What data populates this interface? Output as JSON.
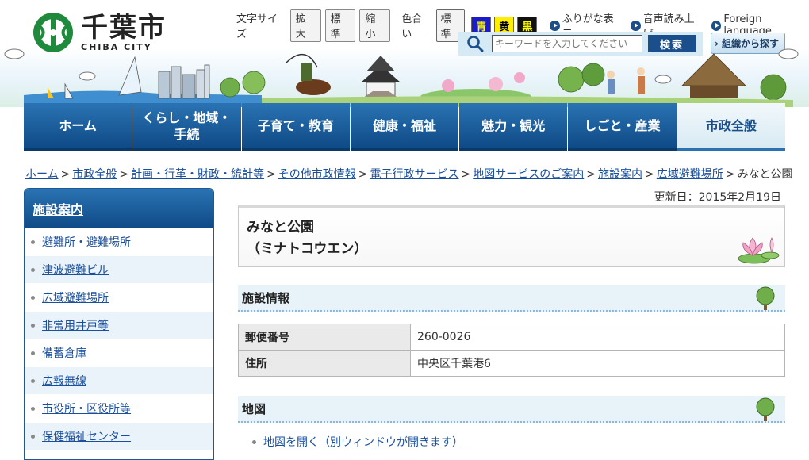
{
  "header": {
    "logo_title": "千葉市",
    "logo_sub": "CHIBA CITY",
    "font_size_label": "文字サイズ",
    "font_sizes": [
      "拡大",
      "標準",
      "縮小"
    ],
    "color_label": "色合い",
    "colors": [
      "標準",
      "青",
      "黄",
      "黒"
    ],
    "links": [
      "ふりがな表示",
      "音声読み上げ",
      "Foreign language"
    ],
    "search_placeholder": "キーワードを入力してください",
    "search_button": "検索",
    "org_button": "組織から探す"
  },
  "nav": {
    "items": [
      "ホーム",
      "くらし・地域・\n手続",
      "子育て・教育",
      "健康・福祉",
      "魅力・観光",
      "しごと・産業",
      "市政全般"
    ],
    "active_index": 6
  },
  "breadcrumb": {
    "links": [
      "ホーム",
      "市政全般",
      "計画・行革・財政・統計等",
      "その他市政情報",
      "電子行政サービス",
      "地図サービスのご案内",
      "施設案内",
      "広域避難場所"
    ],
    "current": "みなと公園",
    "separator": ">"
  },
  "sidebar": {
    "title": "施設案内",
    "items": [
      "避難所・避難場所",
      "津波避難ビル",
      "広域避難場所",
      "非常用井戸等",
      "備蓄倉庫",
      "広報無線",
      "市役所・区役所等",
      "保健福祉センター"
    ]
  },
  "main": {
    "updated": "更新日：2015年2月19日",
    "title_line1": "みなと公園",
    "title_line2": "（ミナトコウエン）",
    "section_info": "施設情報",
    "table": [
      {
        "label": "郵便番号",
        "value": "260-0026"
      },
      {
        "label": "住所",
        "value": "中央区千葉港6"
      }
    ],
    "section_map": "地図",
    "map_link": "地図を開く（別ウィンドウが開きます）"
  },
  "colors": {
    "primary": "#1a4f8a",
    "nav_gradient_top": "#2a73b3",
    "link": "#1a4f9c",
    "logo_green": "#1f8a3c"
  }
}
